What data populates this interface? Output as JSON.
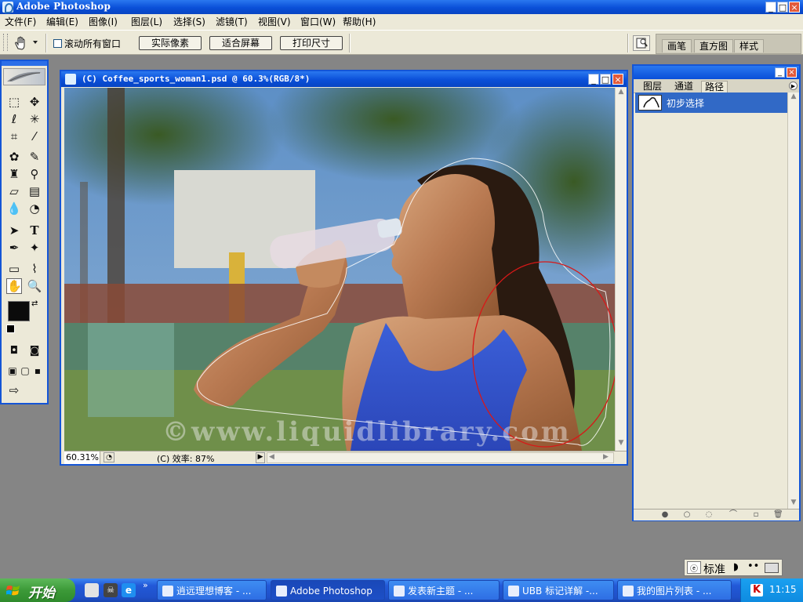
{
  "app": {
    "title": "Adobe Photoshop",
    "window_buttons": [
      "_",
      "□",
      "×"
    ]
  },
  "menu": [
    "文件(F)",
    "编辑(E)",
    "图像(I)",
    "图层(L)",
    "选择(S)",
    "滤镜(T)",
    "视图(V)",
    "窗口(W)",
    "帮助(H)"
  ],
  "options": {
    "scroll_all_windows": "滚动所有窗口",
    "actual_pixels": "实际像素",
    "fit_screen": "适合屏幕",
    "print_size": "打印尺寸",
    "palette_tabs": [
      "画笔",
      "直方图",
      "样式"
    ]
  },
  "document": {
    "title": "(C) Coffee_sports_woman1.psd @ 60.3%(RGB/8*)",
    "zoom": "60.31%",
    "status": "(C) 效率: 87%",
    "watermark": "©www.liquidlibrary.com"
  },
  "paths_panel": {
    "tabs": [
      "图层",
      "通道",
      "路径"
    ],
    "active_tab": "路径",
    "path_name": "初步选择"
  },
  "ime": {
    "mode": "标准"
  },
  "taskbar": {
    "start": "开始",
    "tasks": [
      {
        "label": "逍远理想博客 - ...",
        "active": false
      },
      {
        "label": "Adobe Photoshop",
        "active": true
      },
      {
        "label": "发表新主题 - ...",
        "active": false
      },
      {
        "label": "UBB 标记详解 -...",
        "active": false
      },
      {
        "label": "我的图片列表 - ...",
        "active": false
      }
    ],
    "clock": "11:15"
  },
  "colors": {
    "xp_blue": "#0a4fd8",
    "xp_green": "#3c9a38",
    "panel_bg": "#ece9d8",
    "selection": "#3169c6"
  }
}
